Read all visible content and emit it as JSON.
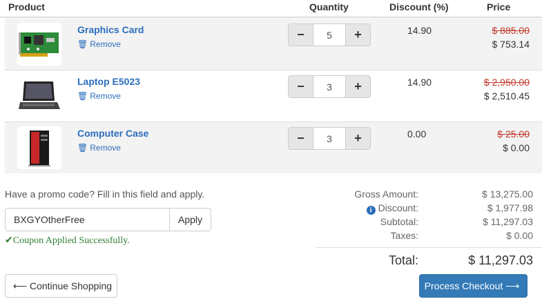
{
  "header": {
    "product": "Product",
    "quantity": "Quantity",
    "discount": "Discount (%)",
    "price": "Price"
  },
  "items": [
    {
      "name": "Graphics Card",
      "remove_label": "Remove",
      "quantity": "5",
      "discount": "14.90",
      "old_price": "$ 885.00",
      "new_price": "$ 753.14",
      "image_icon": "graphics-card-image"
    },
    {
      "name": "Laptop E5023",
      "remove_label": "Remove",
      "quantity": "3",
      "discount": "14.90",
      "old_price": "$ 2,950.00",
      "new_price": "$ 2,510.45",
      "image_icon": "laptop-image"
    },
    {
      "name": "Computer Case",
      "remove_label": "Remove",
      "quantity": "3",
      "discount": "0.00",
      "old_price": "$ 25.00",
      "new_price": "$ 0.00",
      "image_icon": "computer-case-image"
    }
  ],
  "promo": {
    "label": "Have a promo code? Fill in this field and apply.",
    "value": "BXGYOtherFree",
    "apply_label": "Apply",
    "success_message": "Coupon Applied Successfully."
  },
  "summary": {
    "gross_label": "Gross Amount:",
    "gross_value": "$ 13,275.00",
    "discount_label": "Discount:",
    "discount_value": "$ 1,977.98",
    "subtotal_label": "Subtotal:",
    "subtotal_value": "$ 11,297.03",
    "taxes_label": "Taxes:",
    "taxes_value": "$ 0.00",
    "total_label": "Total:",
    "total_value": "$ 11,297.03"
  },
  "buttons": {
    "continue_label": "Continue Shopping",
    "checkout_label": "Process Checkout"
  },
  "colors": {
    "link": "#2a6ebb",
    "strike_price": "#c0392b",
    "success": "#2e7d32",
    "primary_button": "#337ab7",
    "row_stripe": "#f3f3f3"
  }
}
